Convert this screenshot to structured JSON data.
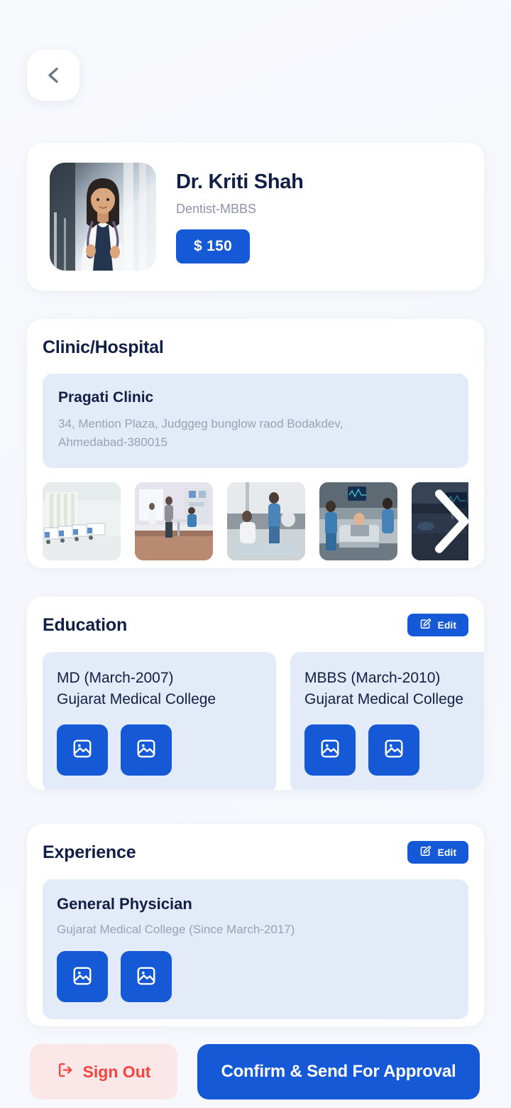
{
  "nav": {
    "back_icon": "chevron-left-icon"
  },
  "profile": {
    "name": "Dr. Kriti Shah",
    "specialty": "Dentist-MBBS",
    "price": "$ 150",
    "avatar_icon": "doctor-portrait-photo"
  },
  "clinic": {
    "section_title": "Clinic/Hospital",
    "name": "Pragati Clinic",
    "address": "34, Mention Plaza, Judggeg bunglow raod Bodakdev, Ahmedabad-380015",
    "gallery": [
      {
        "alt": "hospital-ward-beds-photo"
      },
      {
        "alt": "clinic-consultation-room-photo"
      },
      {
        "alt": "nurse-with-patient-bed-photo"
      },
      {
        "alt": "icu-team-with-patient-photo"
      },
      {
        "alt": "icu-monitor-room-photo"
      }
    ],
    "next_icon": "chevron-right-icon"
  },
  "education": {
    "section_title": "Education",
    "edit_label": "Edit",
    "edit_icon": "edit-pencil-icon",
    "items": [
      {
        "degree": "MD (March-2007)",
        "college": "Gujarat Medical College",
        "attachments": [
          "image-icon",
          "image-icon"
        ]
      },
      {
        "degree": "MBBS (March-2010)",
        "college": "Gujarat Medical College",
        "attachments": [
          "image-icon",
          "image-icon"
        ]
      }
    ]
  },
  "experience": {
    "section_title": "Experience",
    "edit_label": "Edit",
    "edit_icon": "edit-pencil-icon",
    "items": [
      {
        "role": "General Physician",
        "detail": "Gujarat Medical College (Since March-2017)",
        "attachments": [
          "image-icon",
          "image-icon"
        ]
      }
    ]
  },
  "footer": {
    "signout_label": "Sign Out",
    "signout_icon": "logout-icon",
    "confirm_label": "Confirm & Send For Approval"
  },
  "colors": {
    "accent_blue": "#1559d6",
    "panel_blue": "#e3ebf9",
    "text_navy": "#121f45",
    "text_muted": "#9aa1b4",
    "danger_red": "#f4443e",
    "danger_bg": "#fce7e8",
    "page_bg": "#f7f8fd"
  }
}
